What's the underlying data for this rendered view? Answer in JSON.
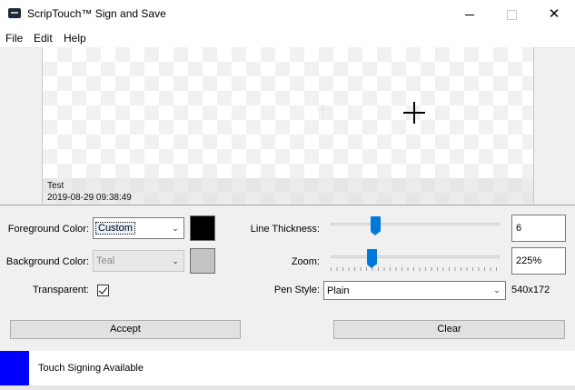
{
  "window": {
    "title": "ScripTouch™ Sign and Save",
    "min_glyph": "",
    "close_glyph": "✕"
  },
  "menu": [
    "File",
    "Edit",
    "Help"
  ],
  "canvas": {
    "signer_name": "Test",
    "timestamp": "2019-08-29 09:38:49"
  },
  "controls": {
    "foreground_color": {
      "label": "Foreground Color:",
      "value": "Custom",
      "swatch": "#000000"
    },
    "background_color": {
      "label": "Background Color:",
      "value": "Teal",
      "swatch": "#c4c4c4"
    },
    "transparent": {
      "label": "Transparent:",
      "checked": true
    },
    "line_thickness": {
      "label": "Line Thickness:",
      "value": "6",
      "level": 0.25
    },
    "zoom": {
      "label": "Zoom:",
      "value": "225%",
      "level": 0.23
    },
    "pen_style": {
      "label": "Pen Style:",
      "value": "Plain",
      "size_text": "540x172"
    }
  },
  "buttons": {
    "accept": "Accept",
    "clear": "Clear"
  },
  "status": {
    "text": "Touch Signing Available",
    "indicator_color": "#0000ff"
  },
  "icons": {
    "dropdown": "chevron-down-icon"
  }
}
